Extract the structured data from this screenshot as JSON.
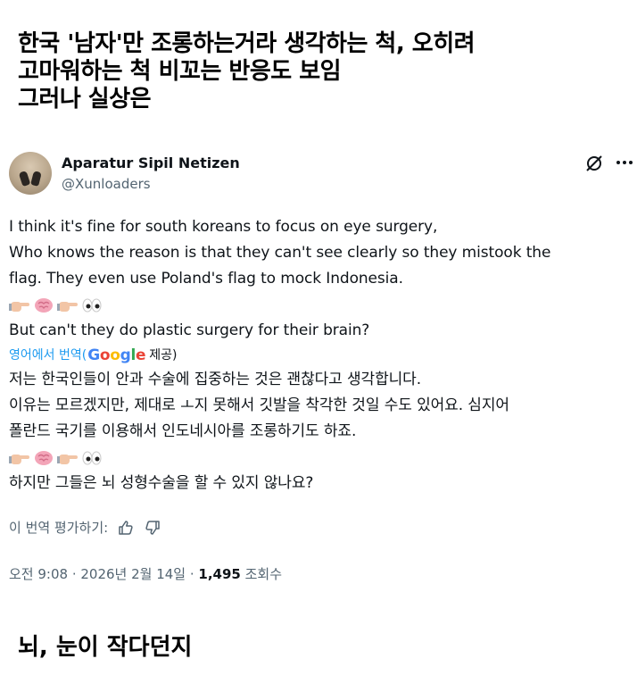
{
  "heading": {
    "line1": "한국 '남자'만 조롱하는거라 생각하는 척, 오히려",
    "line2": "고마워하는 척 비꼬는 반응도 보임",
    "line3": "그러나 실상은"
  },
  "tweet": {
    "display_name": "Aparatur Sipil Netizen",
    "handle": "@Xunloaders",
    "original": {
      "line1": "I think it's fine for south koreans to focus on eye surgery,",
      "line2": "Who knows the reason is that they can't see clearly so they mistook the",
      "line3": "flag. They even use Poland's flag to mock Indonesia.",
      "emoji_names": [
        "hand-pointing-icon",
        "brain-icon",
        "hand-pointing-icon",
        "eyes-icon"
      ],
      "line4": "But can't they do plastic surgery for their brain?"
    },
    "translation_label": {
      "prefix": "영어에서 번역(",
      "provider": "Google",
      "suffix": "제공)"
    },
    "translated": {
      "line1": "저는 한국인들이 안과 수술에 집중하는 것은 괜찮다고 생각합니다.",
      "line2": "이유는 모르겠지만, 제대로 ㅗ지 못해서 깃발을 착각한 것일 수도 있어요. 심지어",
      "line3": "폴란드 국기를 이용해서 인도네시아를 조롱하기도 하죠.",
      "line4": "하지만 그들은 뇌 성형수술을 할 수 있지 않나요?"
    },
    "rate_label": "이 번역 평가하기:",
    "meta": {
      "time": "오전 9:08 · 2026년 2월 14일 · ",
      "views_count": "1,495",
      "views_label": " 조회수"
    }
  },
  "footer": "뇌, 눈이 작다던지",
  "colors": {
    "link": "#1d9bf0",
    "muted": "#536471",
    "text": "#0f1419"
  }
}
